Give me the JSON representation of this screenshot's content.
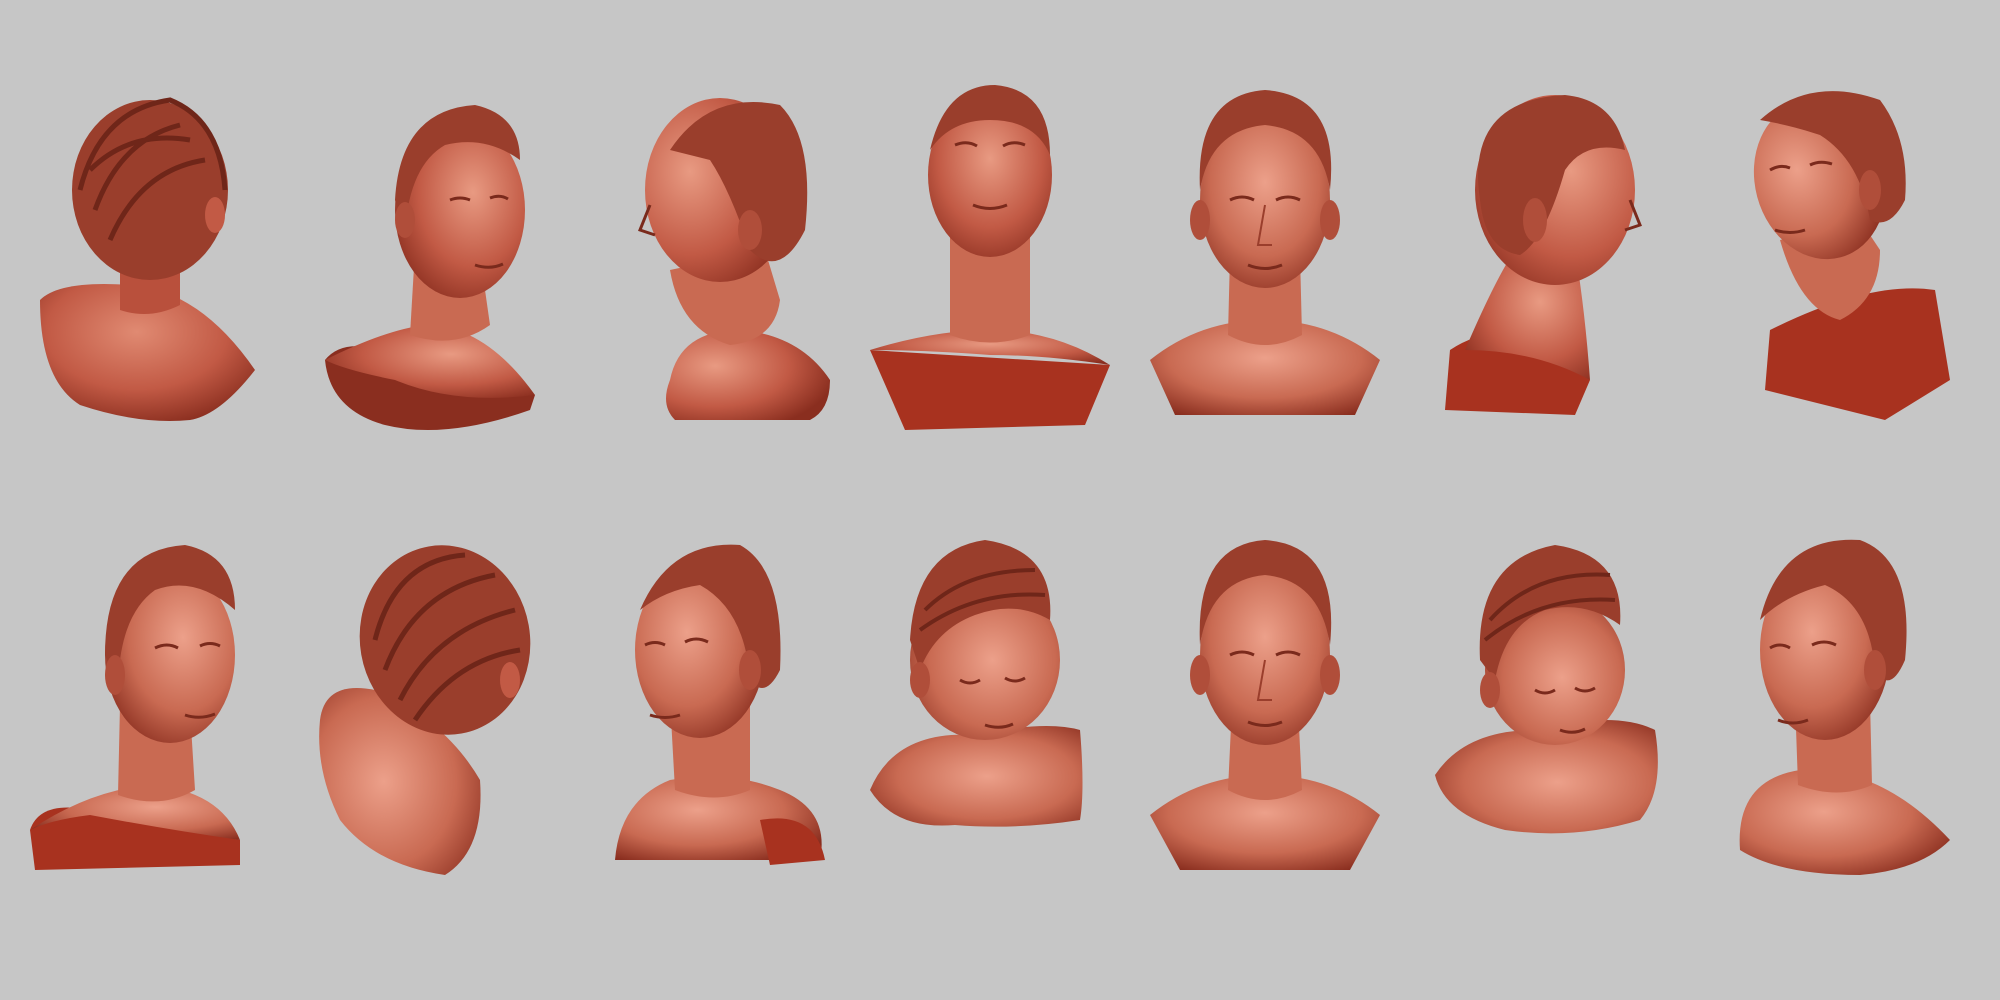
{
  "scene": {
    "background_color": "#c6c6c6",
    "clay_color": "#c25a45",
    "clay_highlight": "#e08a72",
    "clay_shadow": "#8a2e1f",
    "hair_color": "#9a3e2c",
    "views": [
      {
        "id": "v0",
        "view": "back-left",
        "head_turn": -150,
        "head_tilt": 0
      },
      {
        "id": "v1",
        "view": "three-quarter-right",
        "head_turn": 40,
        "head_tilt": 0
      },
      {
        "id": "v2",
        "view": "profile-left",
        "head_turn": -90,
        "head_tilt": 0
      },
      {
        "id": "v3",
        "view": "front-low",
        "head_turn": 0,
        "head_tilt": -20
      },
      {
        "id": "v4",
        "view": "front",
        "head_turn": 0,
        "head_tilt": 0
      },
      {
        "id": "v5",
        "view": "profile-right-back",
        "head_turn": 120,
        "head_tilt": 0
      },
      {
        "id": "v6",
        "view": "three-quarter-left-up",
        "head_turn": -40,
        "head_tilt": -15
      },
      {
        "id": "v7",
        "view": "three-quarter-right",
        "head_turn": 35,
        "head_tilt": 0
      },
      {
        "id": "v8",
        "view": "back-top",
        "head_turn": -160,
        "head_tilt": 25
      },
      {
        "id": "v9",
        "view": "three-quarter-left",
        "head_turn": -35,
        "head_tilt": 5
      },
      {
        "id": "v10",
        "view": "top-down",
        "head_turn": 10,
        "head_tilt": 30
      },
      {
        "id": "v11",
        "view": "front",
        "head_turn": 0,
        "head_tilt": 0
      },
      {
        "id": "v12",
        "view": "top-down-right",
        "head_turn": 20,
        "head_tilt": 35
      },
      {
        "id": "v13",
        "view": "three-quarter-left",
        "head_turn": -25,
        "head_tilt": 0
      }
    ]
  }
}
